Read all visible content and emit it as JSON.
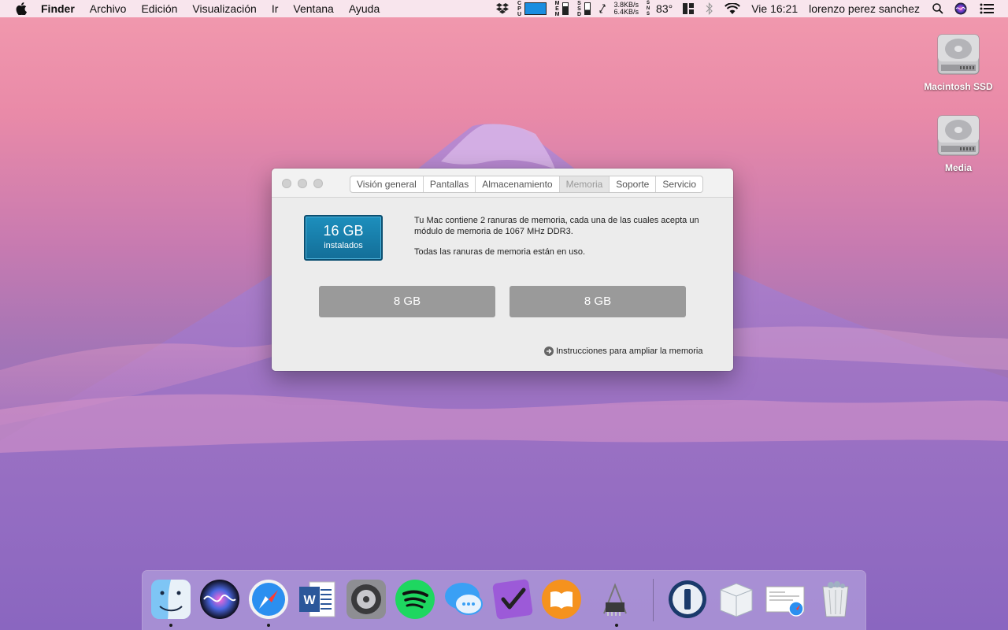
{
  "menubar": {
    "app": "Finder",
    "menus": [
      "Archivo",
      "Edición",
      "Visualización",
      "Ir",
      "Ventana",
      "Ayuda"
    ],
    "net_up": "3.8KB/s",
    "net_down": "6.4KB/s",
    "temperature": "83°",
    "clock": "Vie 16:21",
    "user": "lorenzo perez sanchez"
  },
  "desktop": {
    "icons": [
      {
        "label": "Macintosh SSD"
      },
      {
        "label": "Media"
      }
    ]
  },
  "window": {
    "tabs": [
      "Visión general",
      "Pantallas",
      "Almacenamiento",
      "Memoria",
      "Soporte",
      "Servicio"
    ],
    "active_tab": "Memoria",
    "memory": {
      "size": "16 GB",
      "size_label": "instalados",
      "description_1": "Tu Mac contiene 2 ranuras de memoria, cada una de las cuales acepta un módulo de memoria de 1067 MHz DDR3.",
      "description_2": "Todas las ranuras de memoria están en uso.",
      "slots": [
        "8 GB",
        "8 GB"
      ],
      "link": "Instrucciones para ampliar la memoria"
    }
  },
  "dock": {
    "apps": [
      "finder-icon",
      "siri-icon",
      "safari-icon",
      "word-icon",
      "system-preferences-icon",
      "spotify-icon",
      "messages-icon",
      "omnifocus-icon",
      "ibooks-icon",
      "system-information-icon",
      "1password-icon",
      "package-icon",
      "safari-document-icon",
      "trash-icon"
    ],
    "colors": {
      "accent": "#136e98",
      "slot": "#9a9a9a"
    }
  }
}
